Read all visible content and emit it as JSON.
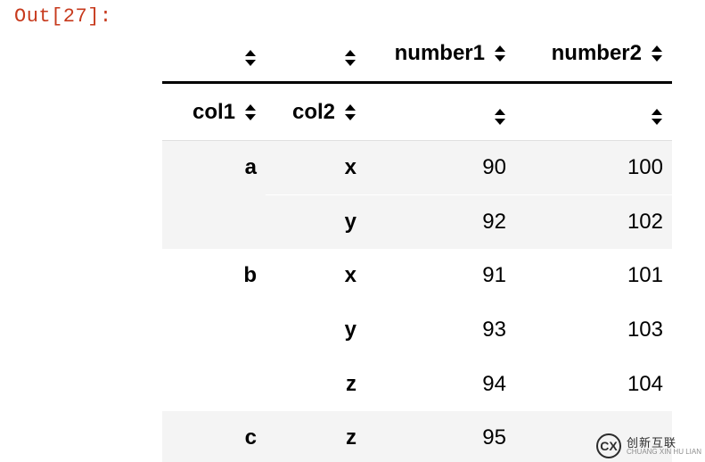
{
  "out_label": "Out[27]:",
  "headers": {
    "level0": [
      "",
      "",
      "number1",
      "number2"
    ],
    "level1": [
      "col1",
      "col2",
      "",
      ""
    ]
  },
  "rows": [
    {
      "col1": "a",
      "col2": "x",
      "number1": "90",
      "number2": "100",
      "showCol1": true,
      "stripe": true,
      "groupStart": true
    },
    {
      "col1": "a",
      "col2": "y",
      "number1": "92",
      "number2": "102",
      "showCol1": false,
      "stripe": true,
      "groupStart": false
    },
    {
      "col1": "b",
      "col2": "x",
      "number1": "91",
      "number2": "101",
      "showCol1": true,
      "stripe": false,
      "groupStart": true
    },
    {
      "col1": "b",
      "col2": "y",
      "number1": "93",
      "number2": "103",
      "showCol1": false,
      "stripe": false,
      "groupStart": false
    },
    {
      "col1": "b",
      "col2": "z",
      "number1": "94",
      "number2": "104",
      "showCol1": false,
      "stripe": false,
      "groupStart": false
    },
    {
      "col1": "c",
      "col2": "z",
      "number1": "95",
      "number2": "",
      "showCol1": true,
      "stripe": true,
      "groupStart": true
    }
  ],
  "watermark": {
    "logo": "CX",
    "title": "创新互联",
    "sub": "CHUANG XIN HU LIAN"
  },
  "chart_data": {
    "type": "table",
    "title": "Out[27]",
    "index_names": [
      "col1",
      "col2"
    ],
    "columns": [
      "number1",
      "number2"
    ],
    "data": [
      {
        "col1": "a",
        "col2": "x",
        "number1": 90,
        "number2": 100
      },
      {
        "col1": "a",
        "col2": "y",
        "number1": 92,
        "number2": 102
      },
      {
        "col1": "b",
        "col2": "x",
        "number1": 91,
        "number2": 101
      },
      {
        "col1": "b",
        "col2": "y",
        "number1": 93,
        "number2": 103
      },
      {
        "col1": "b",
        "col2": "z",
        "number1": 94,
        "number2": 104
      },
      {
        "col1": "c",
        "col2": "z",
        "number1": 95,
        "number2": null
      }
    ]
  }
}
